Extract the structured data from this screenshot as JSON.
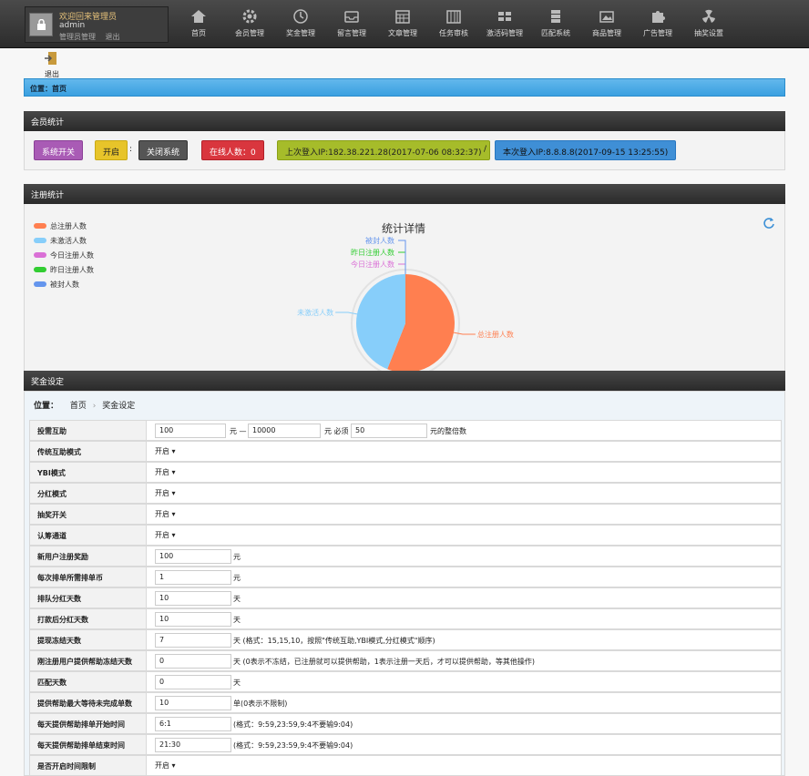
{
  "user": {
    "welcome": "欢迎回来管理员",
    "name": "admin",
    "link_manage": "管理员管理",
    "link_logout": "退出"
  },
  "nav": [
    {
      "label": "首页",
      "icon": "home-icon"
    },
    {
      "label": "会员管理",
      "icon": "gear-icon"
    },
    {
      "label": "奖金管理",
      "icon": "clock-icon"
    },
    {
      "label": "留言管理",
      "icon": "inbox-icon"
    },
    {
      "label": "文章管理",
      "icon": "calendar-icon"
    },
    {
      "label": "任务审核",
      "icon": "grid-icon"
    },
    {
      "label": "激活码管理",
      "icon": "blocks-icon"
    },
    {
      "label": "匹配系统",
      "icon": "server-icon"
    },
    {
      "label": "商品管理",
      "icon": "picture-icon"
    },
    {
      "label": "广告管理",
      "icon": "puzzle-icon"
    },
    {
      "label": "抽奖设置",
      "icon": "radiation-icon"
    }
  ],
  "quit_label": "退出",
  "breadcrumb": "位置：首页",
  "member_stats": {
    "title": "会员统计",
    "system_switch": "系统开关",
    "open": "开启",
    "colon": ":",
    "close_system": "关闭系统",
    "online": "在线人数：0",
    "last_login": "上次登入IP:182.38.221.28(2017-07-06 08:32:37)",
    "slash": "/",
    "this_login": "本次登入IP:8.8.8.8(2017-09-15 13:25:55)"
  },
  "register_stats": {
    "title": "注册统计",
    "chart_title": "统计详情",
    "legend": [
      {
        "label": "总注册人数",
        "color": "#ff7f50"
      },
      {
        "label": "未激活人数",
        "color": "#87cefa"
      },
      {
        "label": "今日注册人数",
        "color": "#da70d6"
      },
      {
        "label": "昨日注册人数",
        "color": "#32cd32"
      },
      {
        "label": "被封人数",
        "color": "#6495ed"
      }
    ]
  },
  "chart_data": {
    "type": "pie",
    "title": "统计详情",
    "categories": [
      "总注册人数",
      "未激活人数",
      "今日注册人数",
      "昨日注册人数",
      "被封人数"
    ],
    "values": [
      56,
      44,
      0,
      0,
      0
    ],
    "colors": [
      "#ff7f50",
      "#87cefa",
      "#da70d6",
      "#32cd32",
      "#6495ed"
    ],
    "legend": "left"
  },
  "bonus": {
    "title": "奖金设定",
    "pos_label": "位置：",
    "pos_home": "首页",
    "pos_sep": "›",
    "pos_current": "奖金设定",
    "rows": [
      {
        "label": "投需互助",
        "kind": "range",
        "v1": "100",
        "t1": "元 —",
        "v2": "10000",
        "t2": "元 必须",
        "v3": "50",
        "t3": "元的整倍数"
      },
      {
        "label": "传统互助模式",
        "kind": "select",
        "value": "开启 ▾"
      },
      {
        "label": "YBI模式",
        "kind": "select",
        "value": "开启 ▾"
      },
      {
        "label": "分红模式",
        "kind": "select",
        "value": "开启 ▾"
      },
      {
        "label": "抽奖开关",
        "kind": "select",
        "value": "开启 ▾"
      },
      {
        "label": "认筹通道",
        "kind": "select",
        "value": "开启 ▾"
      },
      {
        "label": "新用户注册奖励",
        "kind": "input",
        "value": "100",
        "unit": "元"
      },
      {
        "label": "每次排单所需排单币",
        "kind": "input",
        "value": "1",
        "unit": "元"
      },
      {
        "label": "排队分红天数",
        "kind": "input",
        "value": "10",
        "unit": "天"
      },
      {
        "label": "打款后分红天数",
        "kind": "input",
        "value": "10",
        "unit": "天"
      },
      {
        "label": "提现冻结天数",
        "kind": "input",
        "value": "7",
        "unit": "天 (格式：15,15,10，按照\"传统互助,YBI模式,分红模式\"顺序)"
      },
      {
        "label": "刚注册用户提供帮助冻结天数",
        "kind": "input",
        "value": "0",
        "unit": "天 (0表示不冻结，已注册就可以提供帮助，1表示注册一天后，才可以提供帮助，等其他操作)"
      },
      {
        "label": "匹配天数",
        "kind": "input",
        "value": "0",
        "unit": "天"
      },
      {
        "label": "提供帮助最大等待未完成单数",
        "kind": "input",
        "value": "10",
        "unit": "单(0表示不限制)"
      },
      {
        "label": "每天提供帮助排单开始时间",
        "kind": "input",
        "value": "6:1",
        "unit": "(格式：9:59,23:59,9:4不要输9:04)"
      },
      {
        "label": "每天提供帮助排单结束时间",
        "kind": "input",
        "value": "21:30",
        "unit": "(格式：9:59,23:59,9:4不要输9:04)"
      },
      {
        "label": "是否开启时间限制",
        "kind": "select",
        "value": "开启 ▾"
      }
    ]
  }
}
